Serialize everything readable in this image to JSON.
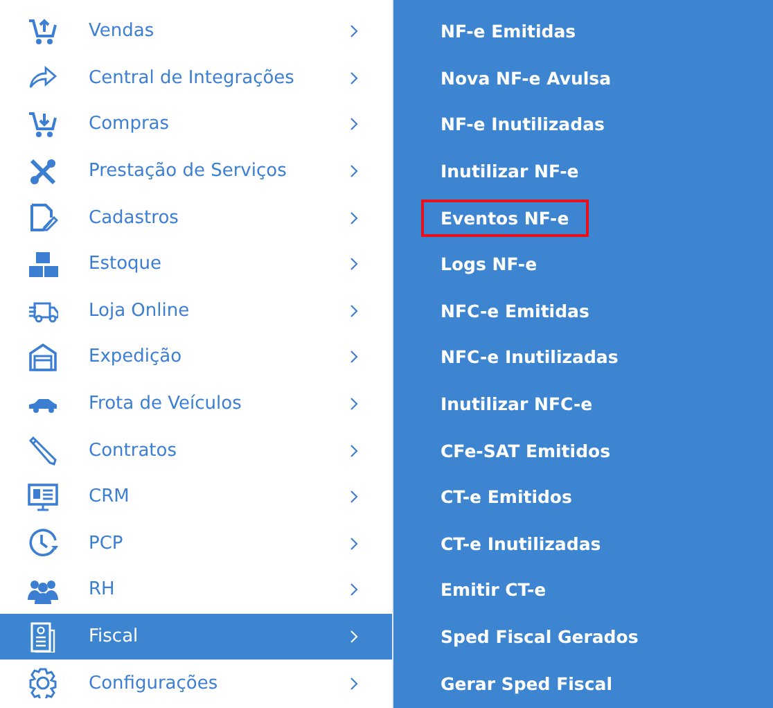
{
  "sidebar": {
    "items": [
      {
        "label": "Vendas",
        "selected": false
      },
      {
        "label": "Central de Integrações",
        "selected": false
      },
      {
        "label": "Compras",
        "selected": false
      },
      {
        "label": "Prestação de Serviços",
        "selected": false
      },
      {
        "label": "Cadastros",
        "selected": false
      },
      {
        "label": "Estoque",
        "selected": false
      },
      {
        "label": "Loja Online",
        "selected": false
      },
      {
        "label": "Expedição",
        "selected": false
      },
      {
        "label": "Frota de Veículos",
        "selected": false
      },
      {
        "label": "Contratos",
        "selected": false
      },
      {
        "label": "CRM",
        "selected": false
      },
      {
        "label": "PCP",
        "selected": false
      },
      {
        "label": "RH",
        "selected": false
      },
      {
        "label": "Fiscal",
        "selected": true
      },
      {
        "label": "Configurações",
        "selected": false
      }
    ]
  },
  "submenu": {
    "items": [
      {
        "label": "NF-e Emitidas",
        "highlighted": false
      },
      {
        "label": "Nova NF-e Avulsa",
        "highlighted": false
      },
      {
        "label": "NF-e Inutilizadas",
        "highlighted": false
      },
      {
        "label": "Inutilizar NF-e",
        "highlighted": false
      },
      {
        "label": "Eventos NF-e",
        "highlighted": true
      },
      {
        "label": "Logs NF-e",
        "highlighted": false
      },
      {
        "label": "NFC-e Emitidas",
        "highlighted": false
      },
      {
        "label": "NFC-e Inutilizadas",
        "highlighted": false
      },
      {
        "label": "Inutilizar NFC-e",
        "highlighted": false
      },
      {
        "label": "CFe-SAT Emitidos",
        "highlighted": false
      },
      {
        "label": "CT-e Emitidos",
        "highlighted": false
      },
      {
        "label": "CT-e Inutilizadas",
        "highlighted": false
      },
      {
        "label": "Emitir CT-e",
        "highlighted": false
      },
      {
        "label": "Sped Fiscal Gerados",
        "highlighted": false
      },
      {
        "label": "Gerar Sped Fiscal",
        "highlighted": false
      }
    ]
  }
}
